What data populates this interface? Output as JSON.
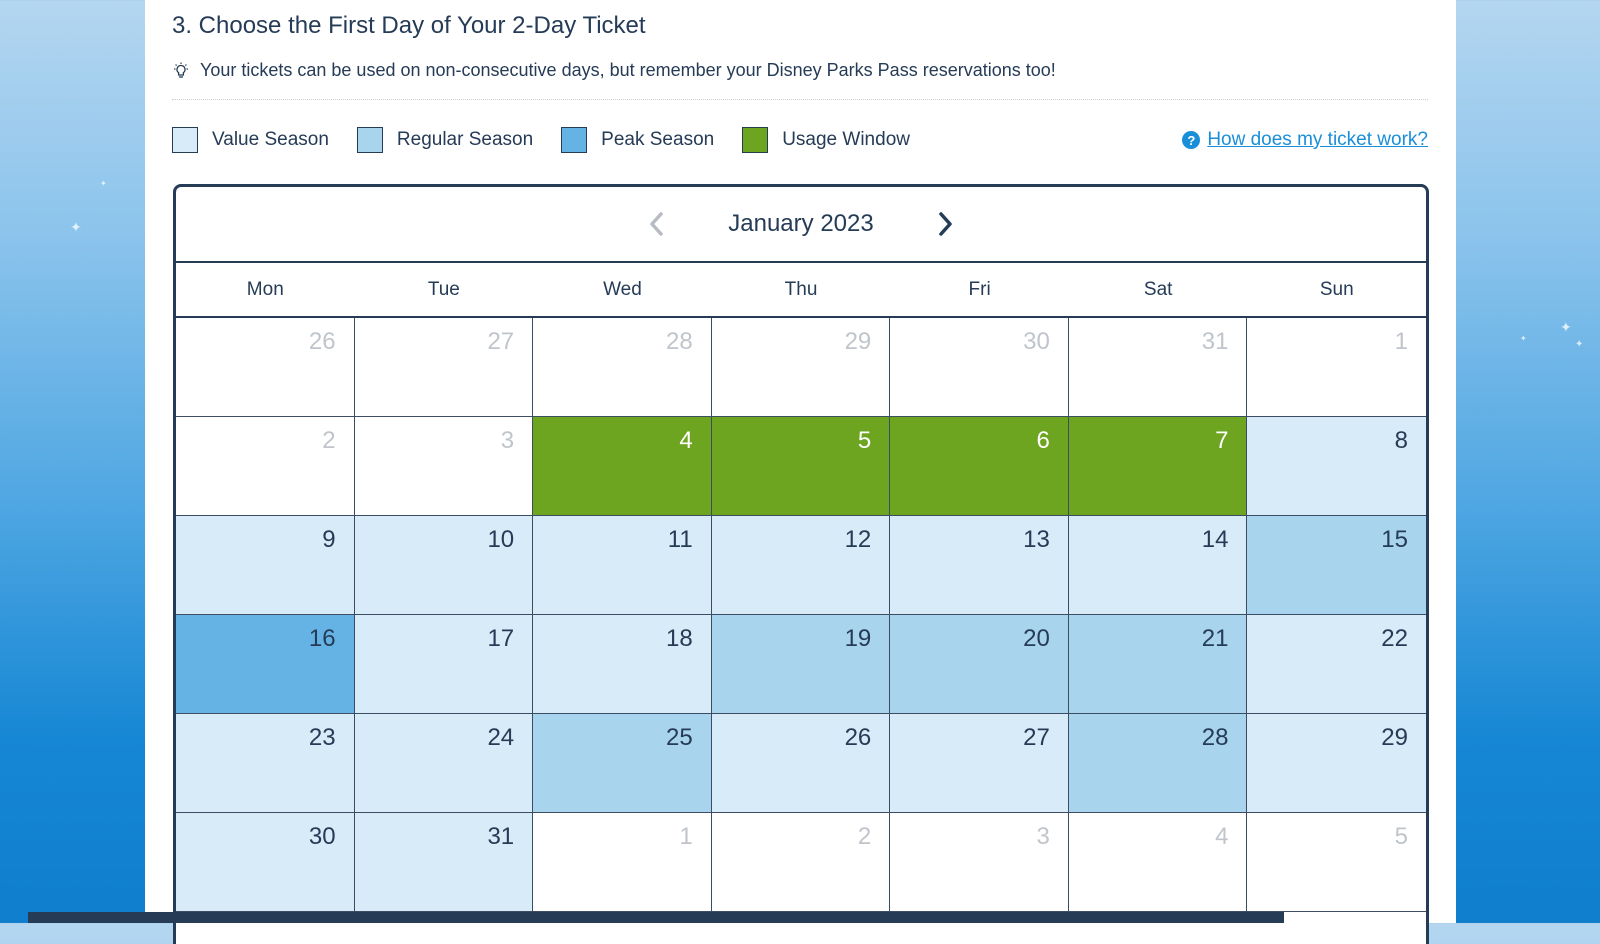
{
  "section": {
    "title": "3. Choose the First Day of Your 2-Day Ticket",
    "tip_icon": "lightbulb-icon",
    "tip": "Your tickets can be used on non-consecutive days, but remember your Disney Parks Pass reservations too!"
  },
  "legend": [
    {
      "label": "Value Season",
      "color": "#d8ebf8"
    },
    {
      "label": "Regular Season",
      "color": "#a9d4ee"
    },
    {
      "label": "Peak Season",
      "color": "#64b3e4"
    },
    {
      "label": "Usage Window",
      "color": "#6da521"
    }
  ],
  "help_link": "How does my ticket work?",
  "help_icon": "question-circle-icon",
  "calendar": {
    "month_label": "January 2023",
    "prev_icon": "chevron-left-icon",
    "next_icon": "chevron-right-icon",
    "weekdays": [
      "Mon",
      "Tue",
      "Wed",
      "Thu",
      "Fri",
      "Sat",
      "Sun"
    ],
    "days": [
      {
        "day": "26",
        "state": "off"
      },
      {
        "day": "27",
        "state": "off"
      },
      {
        "day": "28",
        "state": "off"
      },
      {
        "day": "29",
        "state": "off"
      },
      {
        "day": "30",
        "state": "off"
      },
      {
        "day": "31",
        "state": "off"
      },
      {
        "day": "1",
        "state": "off"
      },
      {
        "day": "2",
        "state": "off"
      },
      {
        "day": "3",
        "state": "off"
      },
      {
        "day": "4",
        "state": "usage"
      },
      {
        "day": "5",
        "state": "usage"
      },
      {
        "day": "6",
        "state": "usage"
      },
      {
        "day": "7",
        "state": "usage"
      },
      {
        "day": "8",
        "state": "value"
      },
      {
        "day": "9",
        "state": "value"
      },
      {
        "day": "10",
        "state": "value"
      },
      {
        "day": "11",
        "state": "value"
      },
      {
        "day": "12",
        "state": "value"
      },
      {
        "day": "13",
        "state": "value"
      },
      {
        "day": "14",
        "state": "value"
      },
      {
        "day": "15",
        "state": "regular"
      },
      {
        "day": "16",
        "state": "peak"
      },
      {
        "day": "17",
        "state": "value"
      },
      {
        "day": "18",
        "state": "value"
      },
      {
        "day": "19",
        "state": "regular"
      },
      {
        "day": "20",
        "state": "regular"
      },
      {
        "day": "21",
        "state": "regular"
      },
      {
        "day": "22",
        "state": "value"
      },
      {
        "day": "23",
        "state": "value"
      },
      {
        "day": "24",
        "state": "value"
      },
      {
        "day": "25",
        "state": "regular"
      },
      {
        "day": "26",
        "state": "value"
      },
      {
        "day": "27",
        "state": "value"
      },
      {
        "day": "28",
        "state": "regular"
      },
      {
        "day": "29",
        "state": "value"
      },
      {
        "day": "30",
        "state": "value"
      },
      {
        "day": "31",
        "state": "value"
      },
      {
        "day": "1",
        "state": "off"
      },
      {
        "day": "2",
        "state": "off"
      },
      {
        "day": "3",
        "state": "off"
      },
      {
        "day": "4",
        "state": "off"
      },
      {
        "day": "5",
        "state": "off"
      }
    ]
  }
}
